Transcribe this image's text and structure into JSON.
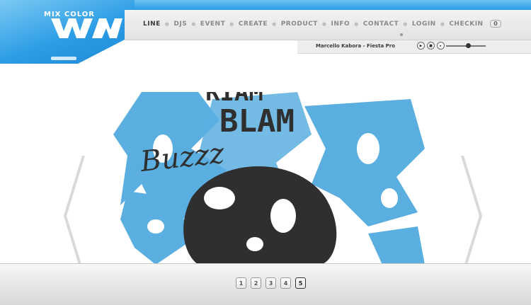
{
  "brand": {
    "small_text": "MIX COLOR",
    "logo_name": "mix-color-logo"
  },
  "nav": {
    "items": [
      {
        "label": "LINE",
        "active": true
      },
      {
        "label": "DJS"
      },
      {
        "label": "EVENT"
      },
      {
        "label": "CREATE"
      },
      {
        "label": "PRODUCT"
      },
      {
        "label": "INFO"
      },
      {
        "label": "CONTACT"
      },
      {
        "label": "LOGIN"
      },
      {
        "label": "CHECKIN"
      }
    ],
    "checkin_count": "0"
  },
  "player": {
    "track": "Marcello Kabora - Fiesta Pro",
    "icons": [
      "play-icon",
      "stop-icon",
      "next-icon"
    ]
  },
  "artwork": {
    "words": [
      "BLAM",
      "RIAM",
      "BLAM",
      "Buzzz"
    ]
  },
  "pagination": {
    "pages": [
      "1",
      "2",
      "3",
      "4",
      "5"
    ],
    "current": "5"
  },
  "colors": {
    "accent": "#2a9be6",
    "art_blue": "#5aaee0",
    "art_dark": "#2f2f2f"
  }
}
